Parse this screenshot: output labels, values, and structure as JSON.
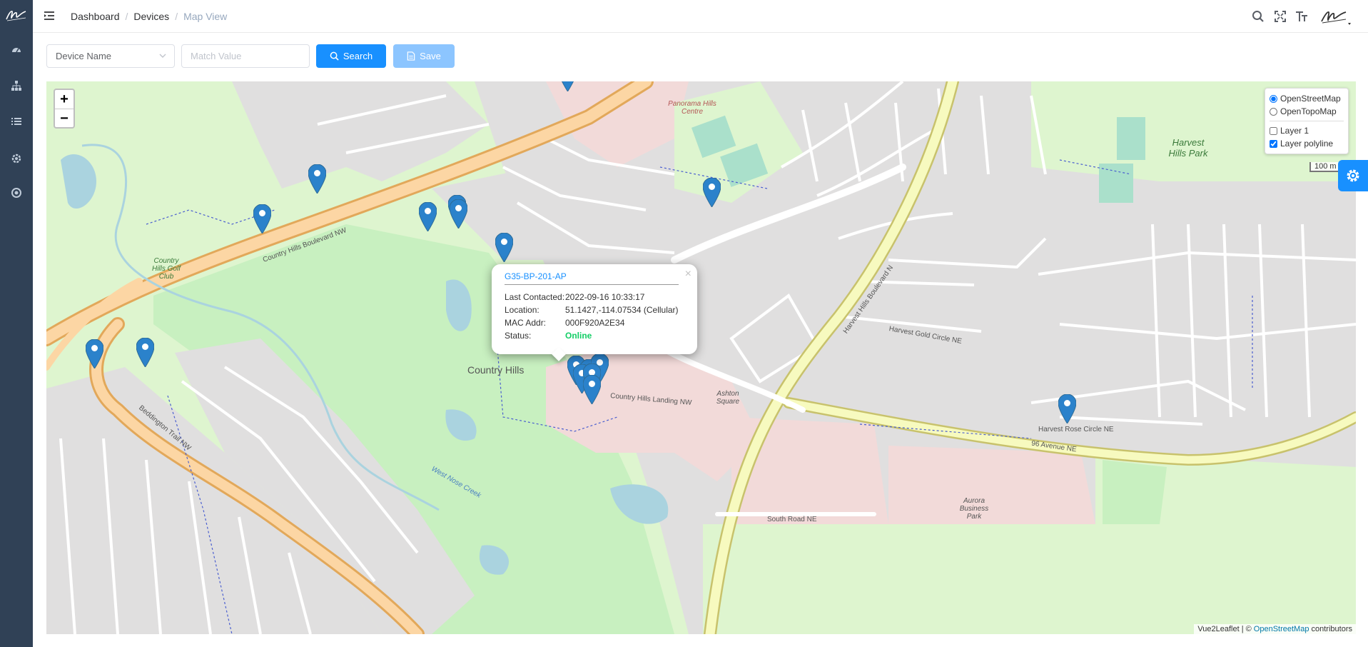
{
  "topbar": {
    "breadcrumb": [
      "Dashboard",
      "Devices",
      "Map View"
    ]
  },
  "filters": {
    "field_select": "Device Name",
    "match_placeholder": "Match Value",
    "search_label": "Search",
    "save_label": "Save"
  },
  "map": {
    "zoom_in": "+",
    "zoom_out": "−",
    "base_layers": [
      {
        "label": "OpenStreetMap",
        "checked": true
      },
      {
        "label": "OpenTopoMap",
        "checked": false
      }
    ],
    "overlays": [
      {
        "label": "Layer 1",
        "checked": false
      },
      {
        "label": "Layer polyline",
        "checked": true
      }
    ],
    "scale": "100 m",
    "attribution": {
      "prefix": "Vue2Leaflet | ©",
      "link": "OpenStreetMap",
      "suffix": "contributors"
    },
    "labels": {
      "country_hills": "Country Hills",
      "harvest_hills_park": "Harvest Hills Park",
      "aurora_business_park": "Aurora Business Park",
      "country_hills_golf_club": "Country Hills Golf Club",
      "panorama_hills_centre": "Panorama Hills Centre",
      "country_hills_blvd": "Country Hills Boulevard NW",
      "beddington_trail": "Beddington Trail NW",
      "ave_96": "96 Avenue NE",
      "harvest_hills_blvd": "Harvest Hills Boulevard N",
      "harvest_rose_circle": "Harvest Rose Circle NE",
      "country_hills_landing": "Country Hills Landing NW",
      "ashton_square": "Ashton Square",
      "west_nose_creek": "West Nose Creek",
      "south_road": "South Road NE",
      "harvest_gold_circle": "Harvest Gold Circle NE"
    },
    "popup": {
      "title": "G35-BP-201-AP",
      "close": "×",
      "rows": [
        {
          "key": "Last Contacted:",
          "value": "2022-09-16 10:33:17"
        },
        {
          "key": "Location:",
          "value": "51.1427,-114.07534 (Cellular)"
        },
        {
          "key": "MAC Addr:",
          "value": "000F920A2E34"
        }
      ],
      "status_key": "Status:",
      "status_value": "Online"
    },
    "colors": {
      "marker": "#2b82cb",
      "accent": "#1890ff",
      "online": "#13ce66"
    }
  }
}
